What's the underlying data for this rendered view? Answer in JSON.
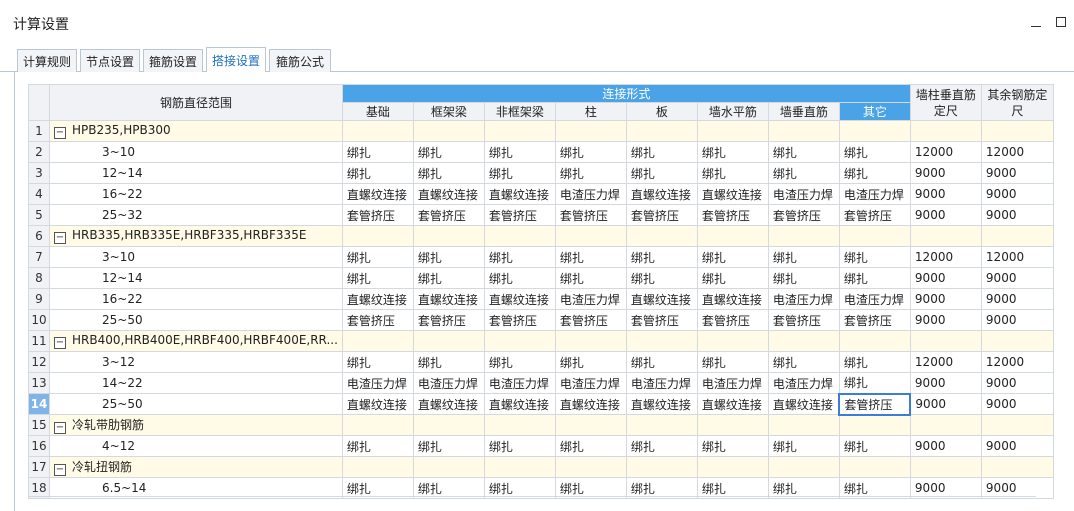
{
  "window": {
    "title": "计算设置"
  },
  "tabs": [
    {
      "label": "计算规则",
      "active": false
    },
    {
      "label": "节点设置",
      "active": false
    },
    {
      "label": "箍筋设置",
      "active": false
    },
    {
      "label": "搭接设置",
      "active": true
    },
    {
      "label": "箍筋公式",
      "active": false
    }
  ],
  "table": {
    "header": {
      "diameter_range": "钢筋直径范围",
      "connection_group": "连接形式",
      "connection_types": [
        "基础",
        "框架梁",
        "非框架梁",
        "柱",
        "板",
        "墙水平筋",
        "墙垂直筋",
        "其它"
      ],
      "wall_column_vertical": "墙柱垂直筋定尺",
      "other_fixed": "其余钢筋定尺",
      "selected_header_index": 7
    },
    "active_row": "14",
    "selected_cell": {
      "row": "14",
      "col": 7
    },
    "rows": [
      {
        "num": "1",
        "group": true,
        "name": "HPB235,HPB300",
        "cells": []
      },
      {
        "num": "2",
        "group": false,
        "name": "3~10",
        "cells": [
          "绑扎",
          "绑扎",
          "绑扎",
          "绑扎",
          "绑扎",
          "绑扎",
          "绑扎",
          "绑扎",
          "12000",
          "12000"
        ]
      },
      {
        "num": "3",
        "group": false,
        "name": "12~14",
        "cells": [
          "绑扎",
          "绑扎",
          "绑扎",
          "绑扎",
          "绑扎",
          "绑扎",
          "绑扎",
          "绑扎",
          "9000",
          "9000"
        ]
      },
      {
        "num": "4",
        "group": false,
        "name": "16~22",
        "cells": [
          "直螺纹连接",
          "直螺纹连接",
          "直螺纹连接",
          "电渣压力焊",
          "直螺纹连接",
          "直螺纹连接",
          "电渣压力焊",
          "电渣压力焊",
          "9000",
          "9000"
        ]
      },
      {
        "num": "5",
        "group": false,
        "name": "25~32",
        "cells": [
          "套管挤压",
          "套管挤压",
          "套管挤压",
          "套管挤压",
          "套管挤压",
          "套管挤压",
          "套管挤压",
          "套管挤压",
          "9000",
          "9000"
        ]
      },
      {
        "num": "6",
        "group": true,
        "name": "HRB335,HRB335E,HRBF335,HRBF335E",
        "cells": []
      },
      {
        "num": "7",
        "group": false,
        "name": "3~10",
        "cells": [
          "绑扎",
          "绑扎",
          "绑扎",
          "绑扎",
          "绑扎",
          "绑扎",
          "绑扎",
          "绑扎",
          "12000",
          "12000"
        ]
      },
      {
        "num": "8",
        "group": false,
        "name": "12~14",
        "cells": [
          "绑扎",
          "绑扎",
          "绑扎",
          "绑扎",
          "绑扎",
          "绑扎",
          "绑扎",
          "绑扎",
          "9000",
          "9000"
        ]
      },
      {
        "num": "9",
        "group": false,
        "name": "16~22",
        "cells": [
          "直螺纹连接",
          "直螺纹连接",
          "直螺纹连接",
          "电渣压力焊",
          "直螺纹连接",
          "直螺纹连接",
          "电渣压力焊",
          "电渣压力焊",
          "9000",
          "9000"
        ]
      },
      {
        "num": "10",
        "group": false,
        "name": "25~50",
        "cells": [
          "套管挤压",
          "套管挤压",
          "套管挤压",
          "套管挤压",
          "套管挤压",
          "套管挤压",
          "套管挤压",
          "套管挤压",
          "9000",
          "9000"
        ]
      },
      {
        "num": "11",
        "group": true,
        "name": "HRB400,HRB400E,HRBF400,HRBF400E,RR...",
        "cells": []
      },
      {
        "num": "12",
        "group": false,
        "name": "3~12",
        "cells": [
          "绑扎",
          "绑扎",
          "绑扎",
          "绑扎",
          "绑扎",
          "绑扎",
          "绑扎",
          "绑扎",
          "12000",
          "12000"
        ]
      },
      {
        "num": "13",
        "group": false,
        "name": "14~22",
        "cells": [
          "电渣压力焊",
          "电渣压力焊",
          "电渣压力焊",
          "电渣压力焊",
          "电渣压力焊",
          "电渣压力焊",
          "电渣压力焊",
          "绑扎",
          "9000",
          "9000"
        ]
      },
      {
        "num": "14",
        "group": false,
        "name": "25~50",
        "cells": [
          "直螺纹连接",
          "直螺纹连接",
          "直螺纹连接",
          "直螺纹连接",
          "直螺纹连接",
          "直螺纹连接",
          "直螺纹连接",
          "套管挤压",
          "9000",
          "9000"
        ]
      },
      {
        "num": "15",
        "group": true,
        "name": "冷轧带肋钢筋",
        "cells": []
      },
      {
        "num": "16",
        "group": false,
        "name": "4~12",
        "cells": [
          "绑扎",
          "绑扎",
          "绑扎",
          "绑扎",
          "绑扎",
          "绑扎",
          "绑扎",
          "绑扎",
          "9000",
          "9000"
        ]
      },
      {
        "num": "17",
        "group": true,
        "name": "冷轧扭钢筋",
        "cells": []
      },
      {
        "num": "18",
        "group": false,
        "name": "6.5~14",
        "cells": [
          "绑扎",
          "绑扎",
          "绑扎",
          "绑扎",
          "绑扎",
          "绑扎",
          "绑扎",
          "绑扎",
          "9000",
          "9000"
        ]
      }
    ]
  }
}
